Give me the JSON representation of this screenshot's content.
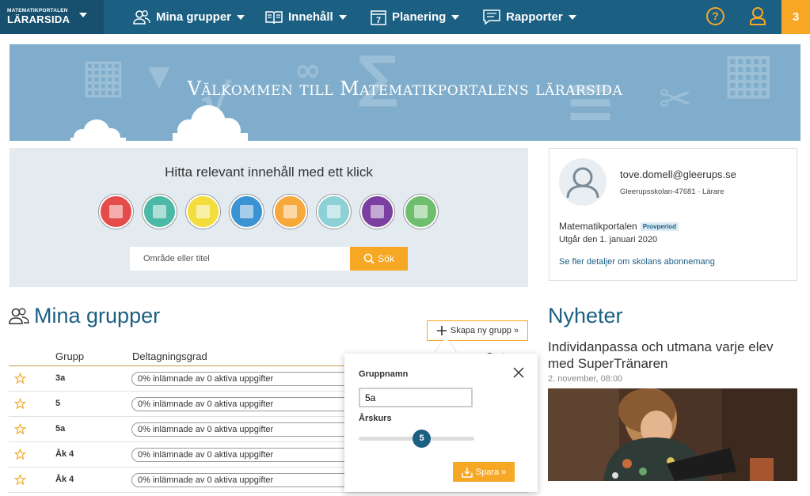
{
  "brand": {
    "line1": "MATEMATIKPORTALEN",
    "line2": "LÄRARSIDA"
  },
  "nav": {
    "groups": "Mina grupper",
    "content": "Innehåll",
    "planning": "Planering",
    "planning_icon_digit": "7",
    "reports": "Rapporter",
    "help": "?",
    "notifications": "3"
  },
  "banner": {
    "title": "Välkommen till Matematikportalens lärarsida"
  },
  "search": {
    "heading": "Hitta relevant innehåll med ett klick",
    "placeholder": "Område eller titel",
    "button": "Sök"
  },
  "categories": [
    {
      "icon": "layers-icon",
      "color": "#e54b4b"
    },
    {
      "icon": "calculator-icon",
      "color": "#4cb8a6"
    },
    {
      "icon": "video-icon",
      "color": "#f2dd3c"
    },
    {
      "icon": "geometry-icon",
      "color": "#3b93d4"
    },
    {
      "icon": "cone-icon",
      "color": "#f6a83b"
    },
    {
      "icon": "worksheet-icon",
      "color": "#8dd0d6"
    },
    {
      "icon": "chart-icon",
      "color": "#7a3fa1"
    },
    {
      "icon": "gears-icon",
      "color": "#6fbe6f"
    }
  ],
  "profile": {
    "email": "tove.domell@gleerups.se",
    "school": "Gleerupsskolan-47681 · Lärare",
    "portal": "Matematikportalen",
    "trial": "Provperiod",
    "expires": "Utgår den 1. januari 2020",
    "details_link": "Se fler detaljer om skolans abonnemang"
  },
  "groups": {
    "title": "Mina grupper",
    "new_button": "Skapa ny grupp »",
    "col_group": "Grupp",
    "col_participation": "Deltagningsgrad",
    "col_sort": "Sorter",
    "rows": [
      {
        "name": "3a",
        "progress": "0% inlämnade av 0 aktiva uppgifter"
      },
      {
        "name": "5",
        "progress": "0% inlämnade av 0 aktiva uppgifter"
      },
      {
        "name": "5a",
        "progress": "0% inlämnade av 0 aktiva uppgifter"
      },
      {
        "name": "Åk 4",
        "progress": "0% inlämnade av 0 aktiva uppgifter"
      },
      {
        "name": "Åk 4",
        "progress": "0% inlämnade av 0 aktiva uppgifter"
      }
    ]
  },
  "popup": {
    "name_label": "Gruppnamn",
    "name_value": "5a",
    "year_label": "Årskurs",
    "year_value": "5",
    "save": "Spara »"
  },
  "news": {
    "title": "Nyheter",
    "headline": "Individanpassa och utmana varje elev med SuperTränaren",
    "date": "2. november, 08:00"
  },
  "colors": {
    "nav": "#1b5f83",
    "accent": "#f6a724",
    "banner": "#80adcb",
    "panel": "#e3ebf1"
  }
}
